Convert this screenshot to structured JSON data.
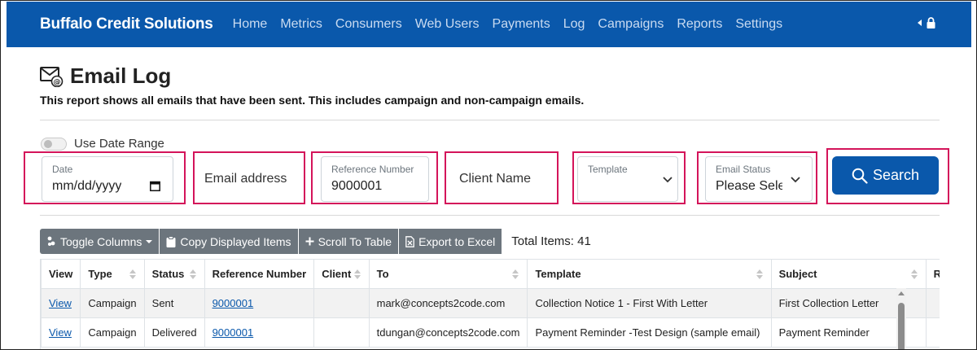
{
  "navbar": {
    "brand": "Buffalo Credit Solutions",
    "links": [
      "Home",
      "Metrics",
      "Consumers",
      "Web Users",
      "Payments",
      "Log",
      "Campaigns",
      "Reports",
      "Settings"
    ]
  },
  "page": {
    "title": "Email Log",
    "subtitle": "This report shows all emails that have been sent. This includes campaign and non-campaign emails."
  },
  "filters": {
    "date_range_label": "Use Date Range",
    "date": {
      "label": "Date",
      "value": "mm/dd/yyyy"
    },
    "email": {
      "placeholder": "Email address"
    },
    "reference": {
      "label": "Reference Number",
      "value": "9000001"
    },
    "client": {
      "placeholder": "Client Name"
    },
    "template": {
      "label": "Template"
    },
    "status": {
      "label": "Email Status",
      "value": "Please Select"
    },
    "search_label": "Search"
  },
  "toolbar": {
    "toggle_columns": "Toggle Columns",
    "copy_items": "Copy Displayed Items",
    "scroll_to_table": "Scroll To Table",
    "export_excel": "Export to Excel",
    "total_items": "Total Items: 41"
  },
  "table": {
    "columns": [
      "View",
      "Type",
      "Status",
      "Reference Number",
      "Client",
      "To",
      "Template",
      "Subject",
      "Re"
    ],
    "rows": [
      [
        "View",
        "Campaign",
        "Sent",
        "9000001",
        "",
        "mark@concepts2code.com",
        "Collection Notice 1 - First With Letter",
        "First Collection Letter",
        ""
      ],
      [
        "View",
        "Campaign",
        "Delivered",
        "9000001",
        "",
        "tdungan@concepts2code.com",
        "Payment Reminder -Test Design (sample email)",
        "Payment Reminder",
        ""
      ]
    ]
  },
  "colors": {
    "primary": "#0a58ab",
    "highlight": "#d4145a",
    "secondary": "#6c757d"
  }
}
